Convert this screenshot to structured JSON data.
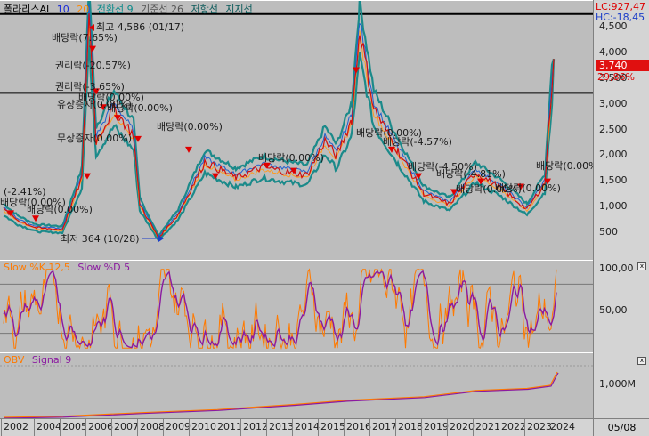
{
  "price_panel": {
    "legend": [
      {
        "text": "폴라리스AI",
        "color": "#000000"
      },
      {
        "text": "10",
        "color": "#1a2bd6"
      },
      {
        "text": "20",
        "color": "#ff8800"
      },
      {
        "text": "전환선 9",
        "color": "#0a8a8a"
      },
      {
        "text": "기준선 26",
        "color": "#555555"
      },
      {
        "text": "저항선",
        "color": "#0a5a5a"
      },
      {
        "text": "지지선",
        "color": "#0a5a5a"
      }
    ],
    "lc_label": "LC:927,47",
    "hc_label": "HC:-18,45",
    "current_price": "3,740",
    "current_change": "29,86%",
    "yticks": [
      "4,500",
      "4,000",
      "3,500",
      "3,000",
      "2,500",
      "2,000",
      "1,500",
      "1,000",
      "500"
    ],
    "high_label": "최고 4,586 (01/17)",
    "low_label": "최저 364 (10/28)",
    "annotations": [
      "배당락(7.65%)",
      "권리락(-20.57%)",
      "권리락(-3.65%)",
      "배당락(0.00%)",
      "유상증자(0.00%)",
      "배당락(0.00%)",
      "무상증자(0.00%)",
      "배당락(0.00%)",
      "(-2.41%)",
      "배당락(0.00%)",
      "배당락(0.00%)",
      "배당락(0.00%)",
      "배당락(0.00%)",
      "배당락(-4.57%)",
      "배당락(-4.50%)",
      "배당락(-4.81%)",
      "배당락(0.00%)",
      "배당락(0.00%)",
      "배당락(0.00%)"
    ]
  },
  "stoch_panel": {
    "legend": [
      {
        "text": "Slow %K 12,5",
        "color": "#ff7a00"
      },
      {
        "text": "Slow %D 5",
        "color": "#8b1aa0"
      }
    ],
    "yticks": [
      "100,00",
      "50,00"
    ]
  },
  "obv_panel": {
    "legend": [
      {
        "text": "OBV",
        "color": "#ff7a00"
      },
      {
        "text": "Signal 9",
        "color": "#8b1aa0"
      }
    ],
    "yticks": [
      "1,000M"
    ]
  },
  "x_axis": {
    "years": [
      "2002",
      "2004",
      "2005",
      "2006",
      "2007",
      "2008",
      "2009",
      "2010",
      "2011",
      "2012",
      "2013",
      "2014",
      "2015",
      "2016",
      "2017",
      "2018",
      "2019",
      "2020",
      "2021",
      "2022",
      "2023",
      "2024"
    ],
    "current_date": "05/08"
  },
  "chart_data": [
    {
      "type": "line",
      "title": "",
      "series": [
        {
          "name": "폴라리스AI",
          "color": "#ff0000"
        }
      ],
      "x": [
        "2002",
        "2003",
        "2004",
        "2005",
        "2005",
        "2006",
        "2006",
        "2007",
        "2007",
        "2008",
        "2008",
        "2009",
        "2010",
        "2011",
        "2012",
        "2013",
        "2014",
        "2015",
        "2015",
        "2016",
        "2016",
        "2017",
        "2018",
        "2019",
        "2020",
        "2021",
        "2022",
        "2023",
        "2024",
        "2024"
      ],
      "y": [
        900,
        700,
        550,
        520,
        1500,
        4586,
        2200,
        2800,
        2300,
        1000,
        364,
        800,
        1800,
        1500,
        1700,
        1600,
        1550,
        2200,
        1900,
        2600,
        4300,
        2800,
        2000,
        1200,
        1000,
        1600,
        1300,
        900,
        1400,
        3740
      ],
      "ylim": [
        0,
        4700
      ],
      "hlines": [
        4586,
        3100
      ]
    },
    {
      "type": "line",
      "series": [
        {
          "name": "Slow %K 12,5",
          "color": "#ff7a00"
        },
        {
          "name": "Slow %D 5",
          "color": "#8b1aa0"
        }
      ],
      "ylim": [
        0,
        100
      ],
      "hlines": [
        80,
        20
      ]
    },
    {
      "type": "line",
      "series": [
        {
          "name": "OBV",
          "color": "#ff7a00"
        },
        {
          "name": "Signal 9",
          "color": "#8b1aa0"
        }
      ],
      "x": [
        "2002",
        "2005",
        "2008",
        "2011",
        "2014",
        "2016",
        "2019",
        "2021",
        "2023",
        "2024",
        "2024"
      ],
      "y": [
        0,
        20,
        90,
        150,
        250,
        330,
        400,
        520,
        560,
        620,
        880
      ],
      "yticks": [
        1000
      ],
      "ylabel": ""
    }
  ]
}
